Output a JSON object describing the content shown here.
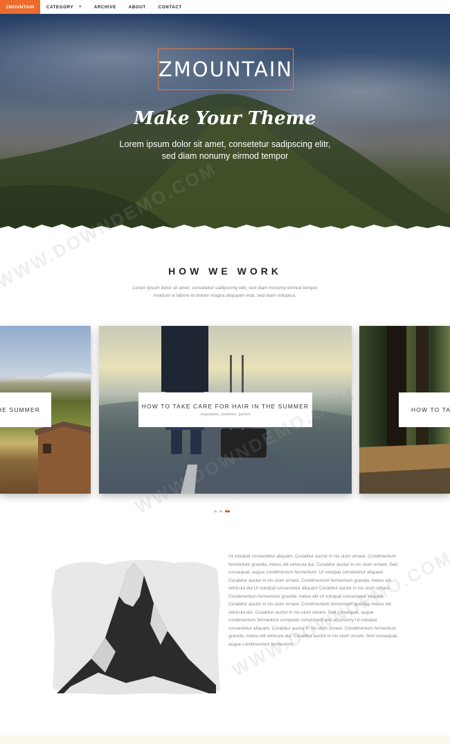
{
  "nav": {
    "brand": "ZMOUNTAIN",
    "items": [
      {
        "label": "CATEGORY",
        "has_dropdown": true
      },
      {
        "label": "ARCHIVE"
      },
      {
        "label": "ABOUT"
      },
      {
        "label": "CONTACT"
      }
    ]
  },
  "hero": {
    "title": "ZMOUNTAIN",
    "tagline": "Make Your Theme",
    "subtitle_line1": "Lorem ipsum dolor sit amet, consetetur sadipscing elitr,",
    "subtitle_line2": "sed diam nonumy eirmod tempor"
  },
  "how_we_work": {
    "title": "HOW WE WORK",
    "text_line1": "Lorem ipsum dolor sit amet, consetetur sadipscing elitr, sed diam nonumy eirmod tempor",
    "text_line2": "invidunt ut labore et dolore magna aliquyam erat, sed diam voluptua."
  },
  "carousel": {
    "cards": [
      {
        "title": "HE SUMMER"
      },
      {
        "title": "HOW TO TAKE CARE FOR HAIR IN THE SUMMER",
        "tags": "vegetables, potatoes, garden"
      },
      {
        "title": "HOW TO TAK"
      }
    ],
    "active_dot": 3,
    "dot_count": 3
  },
  "about": {
    "paragraph": "Ut volutpat consectetur aliquam. Curabitur auctor in nis ulum ornare. Condimentum fermentum gravida, metus elit vehicula dui. Curabitur auctor in nis ulum ornare. Sed consequat, augue condimentum fermentum. Ut volutpat consectetur aliquam. Curabitur auctor in nis ulum ornare. Condimentum fermentum gravida, metus elit vehicula dui Ut volutpat consectetur aliquam Curabitur auctor in nis ulum ornare. Condimentum fermentum gravida, metus elit Ut volutpat consectetur aliquam. Curabitur auctor in nis ulum ornare. Condimentum fermentum gravida, metus elit vehicula dui. Curabitur auctor in nis ulum ornare. Sed consequat, augue condimentum fermentum computer component and accessory Ut volutpat consectetur aliquam. Curabitur auctor in nis ulum ornare. Condimentum fermentum gravida, metus elit vehicula dui. Curabitur auctor in nis ulum ornare. Sed consequat, augue condimentum fermentum"
  },
  "watermark": "WWW.DOWNDEMO.COM",
  "colors": {
    "accent": "#ec6b2d",
    "text_dark": "#222222",
    "text_muted": "#888888"
  }
}
